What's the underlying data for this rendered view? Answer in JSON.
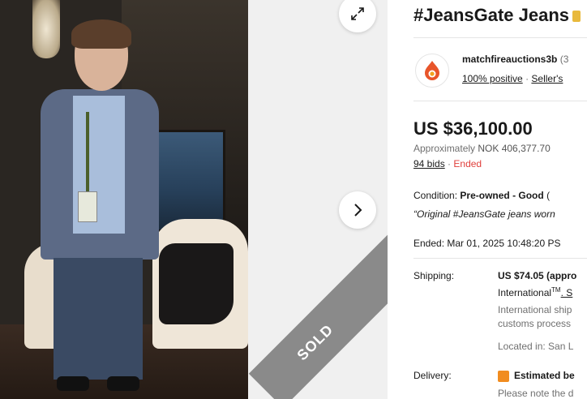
{
  "gallery": {
    "sold_label": "SOLD",
    "expand_icon": "expand-icon",
    "next_icon": "chevron-right-icon"
  },
  "listing": {
    "title": "#JeansGate Jeans",
    "seller": {
      "name": "matchfireauctions3b",
      "count": "(3",
      "positive": "100% positive",
      "separator": "·",
      "sellers_link": "Seller's"
    },
    "price": "US $36,100.00",
    "approx_prefix": "Approximately",
    "approx_value": "NOK 406,377.70",
    "bids": "94 bids",
    "bids_separator": "·",
    "status": "Ended",
    "condition_label": "Condition:",
    "condition_value": "Pre-owned - Good",
    "condition_note": "(",
    "quote": "“Original #JeansGate jeans worn",
    "ended_label": "Ended:",
    "ended_value": "Mar 01, 2025 10:48:20 PS",
    "shipping_label": "Shipping:",
    "shipping_value": "US $74.05 (appro",
    "shipping_intl": "International",
    "shipping_tm": "TM",
    "shipping_intl_suffix": ". S",
    "shipping_note_1": "International ship",
    "shipping_note_2": "customs process",
    "located": "Located in: San L",
    "delivery_label": "Delivery:",
    "delivery_value": "Estimated be",
    "delivery_note": "Please note the d"
  },
  "colors": {
    "ended": "#e0403c",
    "seller_logo": "#e8552a",
    "delivery_flag": "#f18c1f"
  }
}
